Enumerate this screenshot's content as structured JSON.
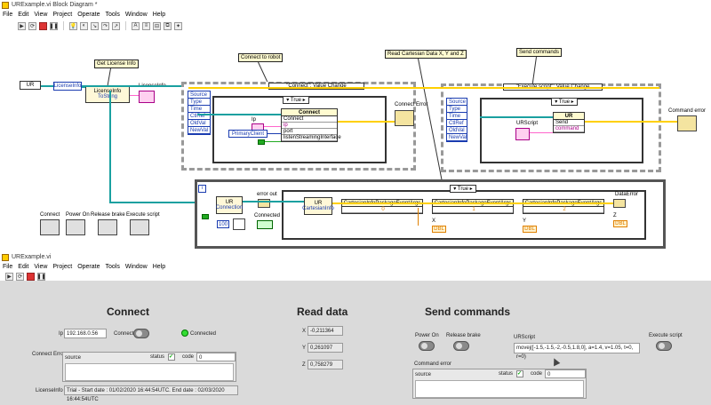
{
  "window1": {
    "title": "URExample.vi Block Diagram *",
    "menu": [
      "File",
      "Edit",
      "View",
      "Project",
      "Operate",
      "Tools",
      "Window",
      "Help"
    ]
  },
  "diagram": {
    "labels": {
      "license": "Get License Info",
      "connect": "Connect to robot",
      "read": "Read Cartesian Data X, Y and Z",
      "send": "Send commands"
    },
    "ur_const": "UR",
    "license_info_node": "LicenseInfo",
    "license_to_string": "ToString",
    "license_info_ind": "LicenseInfo",
    "event_case1_selector": "\"Connect\": Value Change",
    "event_case2_selector": "\"Execute script\": Value Change",
    "event_items": [
      "Source",
      "Type",
      "Time",
      "CtlRef",
      "OldVal",
      "NewVal"
    ],
    "true_label": "True",
    "connect_node_title": "UR",
    "connect_node_rows": [
      "Connect",
      "ip",
      "port",
      "listenStreamingInterface"
    ],
    "ip_label": "Ip",
    "primary_client": "PrimaryClient",
    "connect_error": "Connect Error",
    "command_error": "Command error",
    "urscript_label": "URScript",
    "send_node_title": "UR",
    "send_node_rows": [
      "Send",
      "command"
    ],
    "loop_label": "i",
    "error_out": "error out",
    "connected_label": "Connected",
    "connection_node": "Connection",
    "cartesian_node": "CartesianInfo",
    "event_args": [
      "CartesianInfoPackageEventArgs",
      "CartesianInfoPackageEventArgs",
      "CartesianInfoPackageEventArgs"
    ],
    "index_labels": [
      "0",
      "1",
      "2"
    ],
    "xyz_labels": [
      "X",
      "Y",
      "Z"
    ],
    "data_error": "DataError",
    "wait_ms": "100",
    "buttons": [
      "Connect",
      "Power On",
      "Release brake",
      "Execute script"
    ],
    "dbl": "DBL"
  },
  "window2": {
    "title": "URExample.vi",
    "menu": [
      "File",
      "Edit",
      "View",
      "Project",
      "Operate",
      "Tools",
      "Window",
      "Help"
    ]
  },
  "panel": {
    "connect_title": "Connect",
    "ip_label": "Ip",
    "ip_value": "192.168.0.56",
    "connect_button": "Connect",
    "connected_label": "Connected",
    "connect_error_label": "Connect Error",
    "status_label": "status",
    "code_label": "code",
    "code_value": "0",
    "source_label": "source",
    "license_label": "LicenseInfo",
    "license_value": "Trial - Start date : 01/02/2020 16:44:54UTC. End date : 02/03/2020 16:44:54UTC",
    "read_title": "Read data",
    "x_label": "X",
    "x_value": "-0,211364",
    "y_label": "Y",
    "y_value": "0,261097",
    "z_label": "Z",
    "z_value": "0,758279",
    "send_title": "Send commands",
    "power_on": "Power On",
    "release_brake": "Release brake",
    "urscript_label": "URScript",
    "urscript_value": "movej([-1.5,-1.5,-2,-0.5,1.8,0], a=1.4, v=1.05, t=0, r=0)",
    "execute_script": "Execute script",
    "command_error_label": "Command error",
    "cmd_status_label": "status",
    "cmd_code_label": "code",
    "cmd_code_value": "0",
    "cmd_source_label": "source"
  },
  "colors": {
    "wire_yellow": "#ffd000",
    "wire_teal": "#1aa0a0",
    "wire_pink": "#ff66cc",
    "led_green": "#33dd33"
  }
}
